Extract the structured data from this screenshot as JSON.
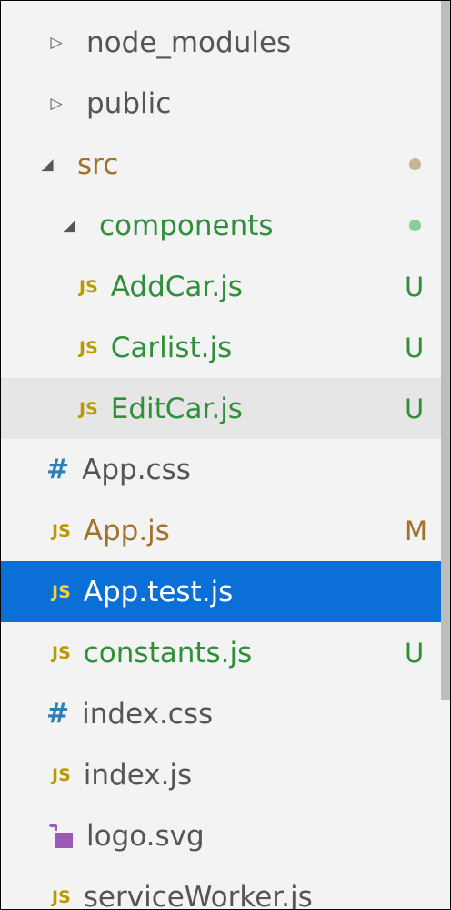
{
  "explorer": {
    "items": [
      {
        "label": "node_modules",
        "kind": "folder-closed",
        "indent": 1,
        "color": "gray"
      },
      {
        "label": "public",
        "kind": "folder-closed",
        "indent": 1,
        "color": "gray"
      },
      {
        "label": "src",
        "kind": "folder-open",
        "indent": 1,
        "color": "brown",
        "decoration": "dot",
        "decoration_color": "#c8b497"
      },
      {
        "label": "components",
        "kind": "folder-open",
        "indent": 2,
        "color": "green",
        "decoration": "dot",
        "decoration_color": "#8fcc93"
      },
      {
        "label": "AddCar.js",
        "kind": "js",
        "icon_text": "JS",
        "indent": 3,
        "color": "green",
        "status": "U"
      },
      {
        "label": "Carlist.js",
        "kind": "js",
        "icon_text": "JS",
        "indent": 3,
        "color": "green",
        "status": "U"
      },
      {
        "label": "EditCar.js",
        "kind": "js",
        "icon_text": "JS",
        "indent": 3,
        "color": "green",
        "status": "U",
        "state": "hover"
      },
      {
        "label": "App.css",
        "kind": "css",
        "icon_text": "#",
        "indent": 2,
        "color": "gray"
      },
      {
        "label": "App.js",
        "kind": "js",
        "icon_text": "JS",
        "indent": 2,
        "color": "brown",
        "status": "M"
      },
      {
        "label": "App.test.js",
        "kind": "js",
        "icon_text": "JS",
        "indent": 2,
        "color": "white",
        "state": "selected"
      },
      {
        "label": "constants.js",
        "kind": "js",
        "icon_text": "JS",
        "indent": 2,
        "color": "green",
        "status": "U"
      },
      {
        "label": "index.css",
        "kind": "css",
        "icon_text": "#",
        "indent": 2,
        "color": "gray"
      },
      {
        "label": "index.js",
        "kind": "js",
        "icon_text": "JS",
        "indent": 2,
        "color": "gray"
      },
      {
        "label": "logo.svg",
        "kind": "svg",
        "icon": "svg-file-icon",
        "indent": 2,
        "color": "gray"
      },
      {
        "label": "serviceWorker.js",
        "kind": "js",
        "icon_text": "JS",
        "indent": 2,
        "color": "gray"
      }
    ]
  },
  "colors": {
    "selection": "#0a70d8",
    "hover": "#e6e6e6",
    "untracked": "#2f8f3a",
    "modified": "#a0722a",
    "js_icon": "#b89a00",
    "css_icon": "#2f7fb7",
    "svg_icon": "#9b59b6"
  }
}
